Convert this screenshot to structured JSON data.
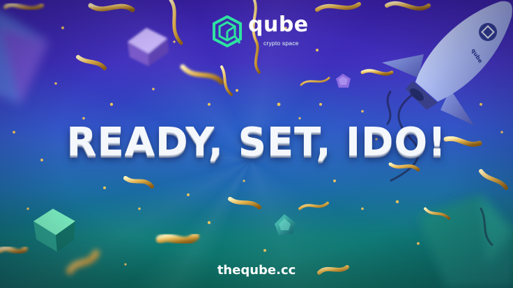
{
  "brand": {
    "name": "qube",
    "tagline": "crypto space",
    "logo_icon": "qube-cube-logo",
    "logo_color": "#2ee3a0"
  },
  "headline": "READY, SET, IDO!",
  "website": "thequbecc",
  "website_display": "theqube.cc",
  "rocket_badge_text": "qube",
  "colors": {
    "background_top": "#3a1fa8",
    "background_mid": "#2a4fc4",
    "background_bottom": "#0b6b5a",
    "confetti_gold": "#e0b04a",
    "headline_text": "#f4f7fb"
  },
  "decorations": {
    "rocket_icon": "rocket-icon",
    "cube_icon": "cube-icon",
    "confetti_icon": "confetti-streamer-icon"
  }
}
